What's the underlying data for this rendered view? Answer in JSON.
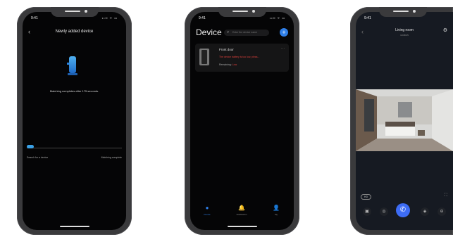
{
  "status": {
    "time": "9:41",
    "icons": "••ll ᯤ ▭"
  },
  "phone1": {
    "back_icon": "‹",
    "title": "Newly added device",
    "matching_text": "Matching completes after 175 seconds.",
    "left_label": "Search for a device",
    "right_label": "Matching complete"
  },
  "phone2": {
    "title": "Device",
    "search_icon": "⌕",
    "search_placeholder": "Enter the device name",
    "add_icon": "+",
    "card": {
      "name": "Front door",
      "more_icon": "···",
      "warning": "The device battery is too low, pleas...",
      "battery_label": "Remaining: ",
      "battery_value": "Low"
    },
    "tabs": [
      {
        "label": "Device",
        "icon": "●"
      },
      {
        "label": "Notification",
        "icon": "🔔"
      },
      {
        "label": "My",
        "icon": "👤"
      }
    ]
  },
  "phone3": {
    "back_icon": "‹",
    "title": "Living room",
    "subtitle": "10:08:25",
    "gear_icon": "⚙",
    "stop_label": "HD",
    "fullscreen_icon": "⛶",
    "controls": [
      {
        "name": "screenshot",
        "icon": "▣"
      },
      {
        "name": "record",
        "icon": "◎"
      },
      {
        "name": "call",
        "icon": "✆"
      },
      {
        "name": "unlock",
        "icon": "◈"
      },
      {
        "name": "more",
        "icon": "⊖"
      }
    ]
  },
  "colors": {
    "accent_blue": "#2f7fe8",
    "warning_red": "#e0413c",
    "lock_blue": "#3aa1e6"
  }
}
